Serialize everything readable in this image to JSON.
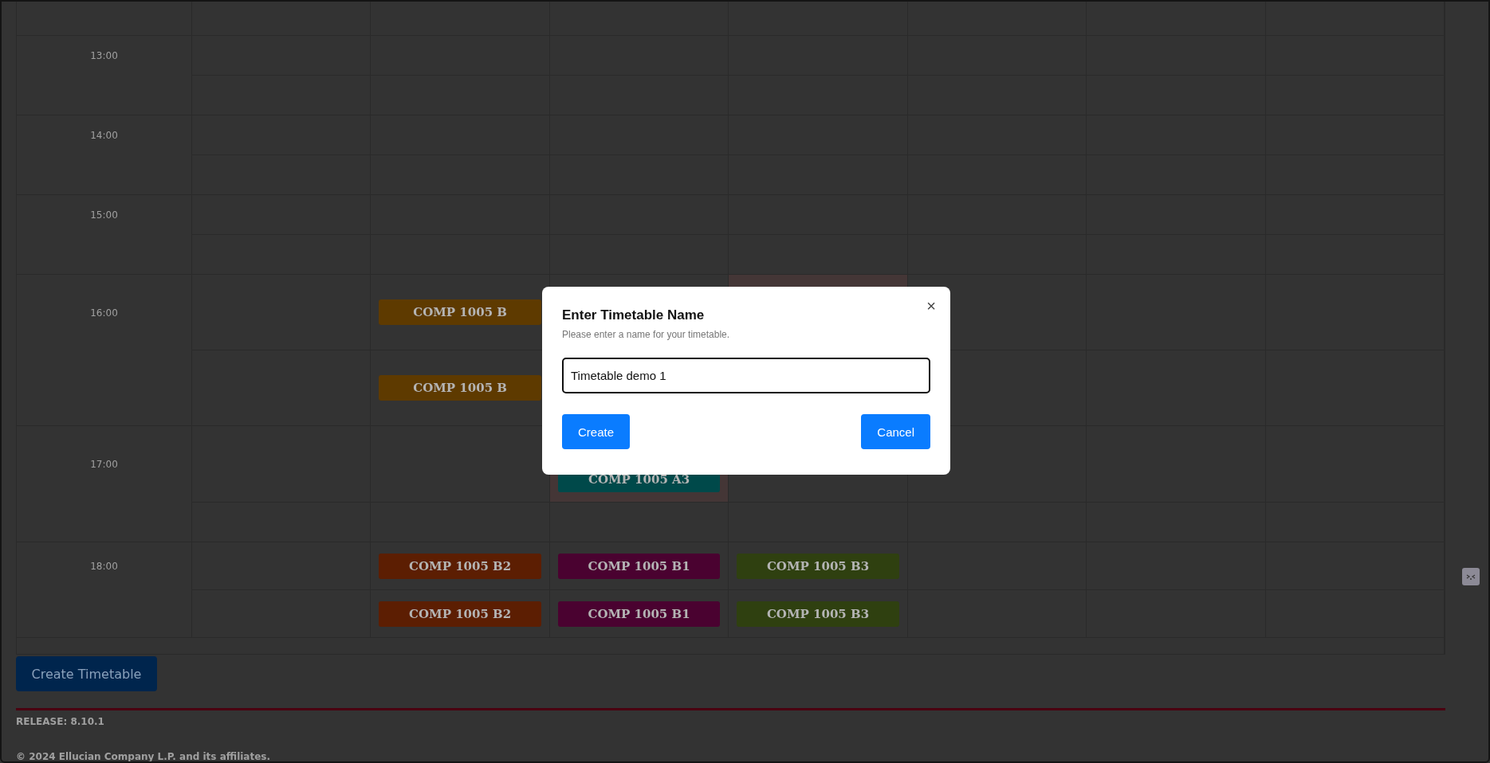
{
  "timetable": {
    "hours": [
      {
        "time": "13:00",
        "slots": [
          {
            "cells": [
              {
                "highlighted": false
              },
              {
                "highlighted": false
              },
              {
                "highlighted": false
              },
              {
                "highlighted": false
              },
              {
                "highlighted": false
              },
              {
                "highlighted": false
              },
              {
                "highlighted": false
              }
            ]
          },
          {
            "cells": [
              {
                "highlighted": false
              },
              {
                "highlighted": false
              },
              {
                "highlighted": false
              },
              {
                "highlighted": false
              },
              {
                "highlighted": false
              },
              {
                "highlighted": false
              },
              {
                "highlighted": false
              }
            ]
          }
        ]
      },
      {
        "time": "14:00",
        "slots": [
          {
            "cells": [
              {
                "highlighted": false
              },
              {
                "highlighted": false
              },
              {
                "highlighted": false
              },
              {
                "highlighted": false
              },
              {
                "highlighted": false
              },
              {
                "highlighted": false
              },
              {
                "highlighted": false
              }
            ]
          },
          {
            "cells": [
              {
                "highlighted": false
              },
              {
                "highlighted": false
              },
              {
                "highlighted": false
              },
              {
                "highlighted": false
              },
              {
                "highlighted": false
              },
              {
                "highlighted": false
              },
              {
                "highlighted": false
              }
            ]
          }
        ]
      },
      {
        "time": "15:00",
        "slots": [
          {
            "cells": [
              {
                "highlighted": false
              },
              {
                "highlighted": false
              },
              {
                "highlighted": false
              },
              {
                "highlighted": false
              },
              {
                "highlighted": false
              },
              {
                "highlighted": false
              },
              {
                "highlighted": false
              }
            ]
          },
          {
            "cells": [
              {
                "highlighted": false
              },
              {
                "highlighted": false
              },
              {
                "highlighted": false
              },
              {
                "highlighted": false
              },
              {
                "highlighted": false
              },
              {
                "highlighted": false
              },
              {
                "highlighted": false
              }
            ]
          }
        ]
      },
      {
        "time": "16:00",
        "slots": [
          {
            "cells": [
              {
                "highlighted": false
              },
              {
                "highlighted": false,
                "event": {
                  "label": "COMP 1005 B",
                  "color": "#5e3a00"
                }
              },
              {
                "highlighted": false
              },
              {
                "highlighted": true
              },
              {
                "highlighted": false
              },
              {
                "highlighted": false
              },
              {
                "highlighted": false
              }
            ]
          },
          {
            "cells": [
              {
                "highlighted": false
              },
              {
                "highlighted": false,
                "event": {
                  "label": "COMP 1005 B",
                  "color": "#5e3a00"
                }
              },
              {},
              {},
              {
                "highlighted": false
              },
              {
                "highlighted": false
              },
              {
                "highlighted": false
              }
            ]
          }
        ]
      },
      {
        "time": "17:00",
        "slots": [
          {
            "cells": [
              {
                "highlighted": false
              },
              {
                "highlighted": false
              },
              {
                "highlighted": true,
                "event": {
                  "label": "COMP 1005 A3",
                  "color": "#00494a"
                }
              },
              {
                "highlighted": false
              },
              {
                "highlighted": false
              },
              {
                "highlighted": false
              },
              {
                "highlighted": false
              }
            ]
          },
          {
            "cells": [
              {
                "highlighted": false
              },
              {
                "highlighted": false
              },
              {
                "highlighted": false
              },
              {
                "highlighted": false
              },
              {
                "highlighted": false
              },
              {
                "highlighted": false
              },
              {
                "highlighted": false
              }
            ]
          }
        ]
      },
      {
        "time": "18:00",
        "slots": [
          {
            "cells": [
              {
                "highlighted": false
              },
              {
                "highlighted": false,
                "event": {
                  "label": "COMP 1005 B2",
                  "color": "#5c1e02"
                }
              },
              {
                "highlighted": false,
                "event": {
                  "label": "COMP 1005 B1",
                  "color": "#4a0230"
                }
              },
              {
                "highlighted": false,
                "event": {
                  "label": "COMP 1005 B3",
                  "color": "#2f4010"
                }
              },
              {
                "highlighted": false
              },
              {
                "highlighted": false
              },
              {
                "highlighted": false
              }
            ]
          },
          {
            "cells": [
              {
                "highlighted": false
              },
              {
                "highlighted": false,
                "event": {
                  "label": "COMP 1005 B2",
                  "color": "#5c1e02"
                }
              },
              {
                "highlighted": false,
                "event": {
                  "label": "COMP 1005 B1",
                  "color": "#4a0230"
                }
              },
              {
                "highlighted": false,
                "event": {
                  "label": "COMP 1005 B3",
                  "color": "#2f4010"
                }
              },
              {
                "highlighted": false
              },
              {
                "highlighted": false
              },
              {
                "highlighted": false
              }
            ]
          }
        ]
      }
    ]
  },
  "create_button": "Create Timetable",
  "footer": {
    "release": "RELEASE: 8.10.1",
    "copyright": "© 2024 Ellucian Company L.P. and its affiliates."
  },
  "dialog": {
    "title": "Enter Timetable Name",
    "subtitle": "Please enter a name for your timetable.",
    "close": "×",
    "name_value": "Timetable demo 1",
    "buttons": [
      "Create",
      "Cancel"
    ]
  }
}
